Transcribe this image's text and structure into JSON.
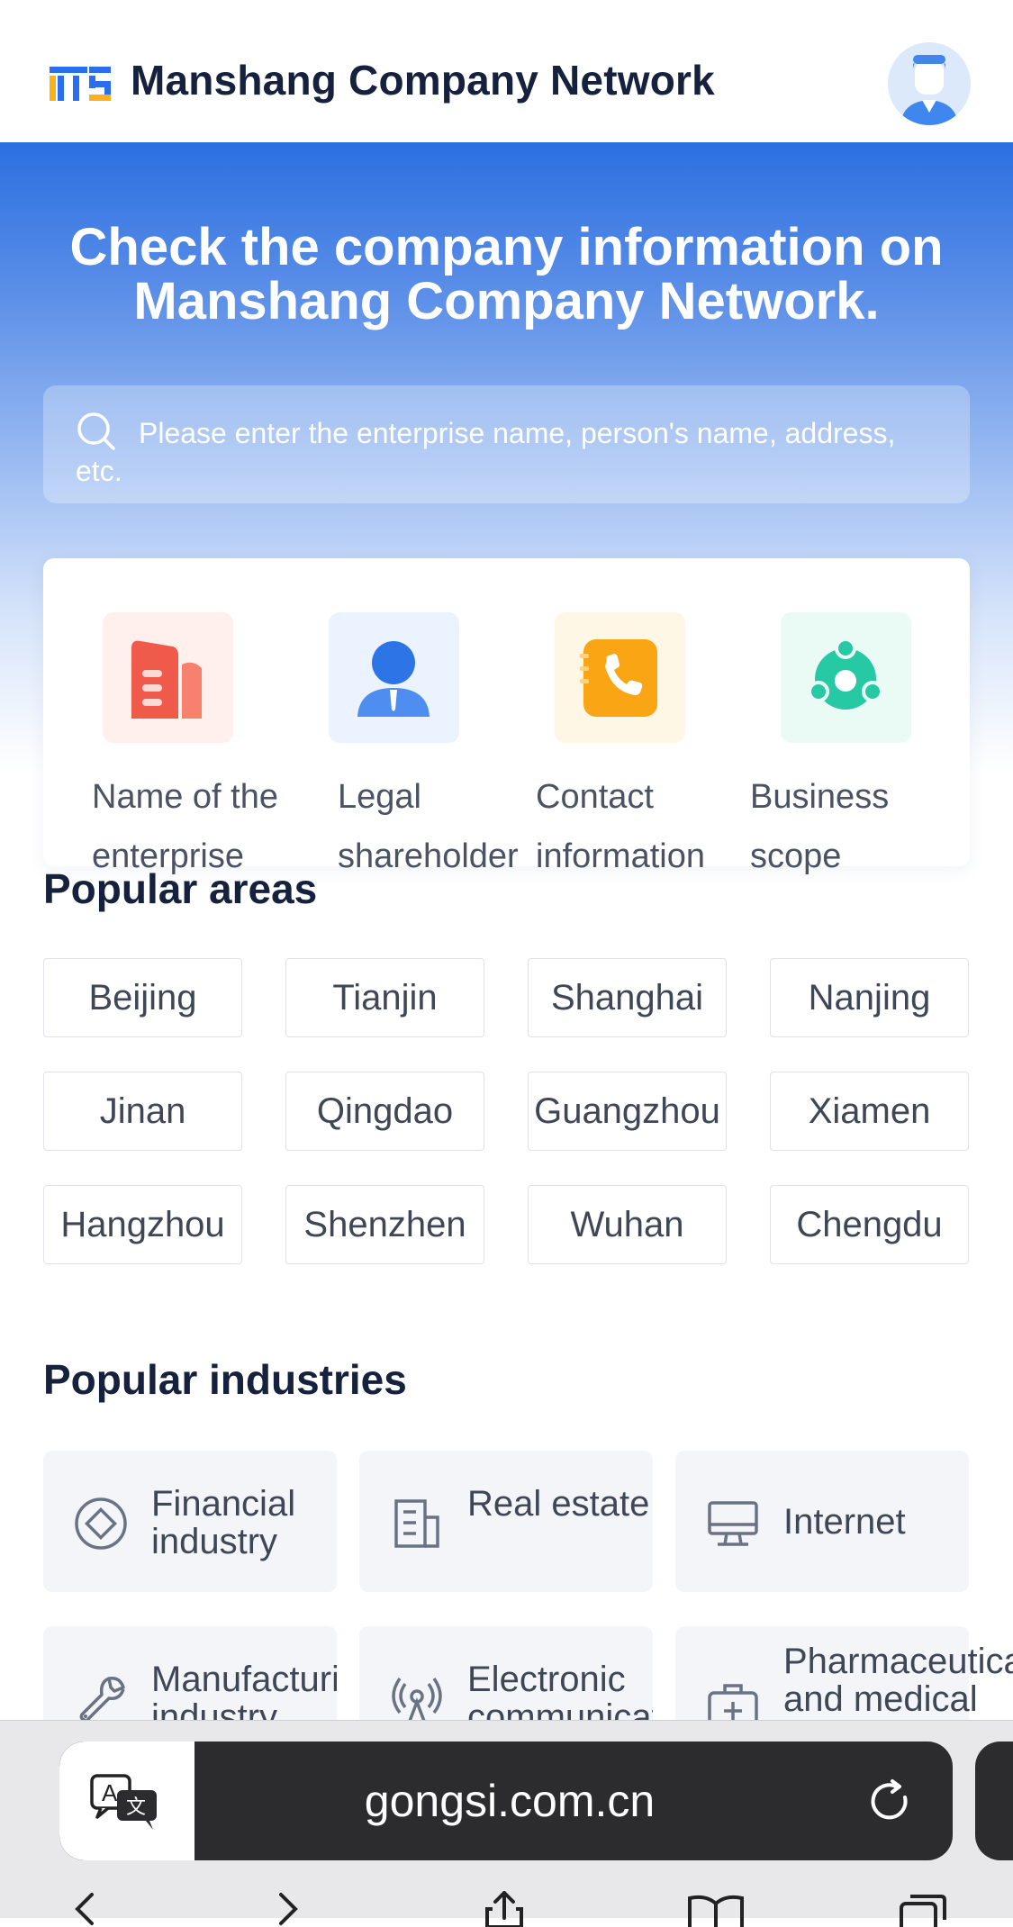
{
  "header": {
    "brand": "Manshang Company Network",
    "logo_icon": "mts-logo-icon",
    "avatar_icon": "user-avatar-icon",
    "colors": {
      "logo_blue": "#2a6ef0",
      "logo_orange": "#f7b21c",
      "brand_text": "#16213d"
    }
  },
  "hero": {
    "title": "Check the company information on Manshang Company Network.",
    "search": {
      "icon": "search-icon",
      "placeholder": "Please enter the enterprise name, person's name, address, etc."
    },
    "gradient": {
      "top": "#2b6fe0",
      "bottom": "#ffffff"
    }
  },
  "features": [
    {
      "icon": "building-icon",
      "label": "Name of the enterprise",
      "color": "#f05a4a"
    },
    {
      "icon": "person-icon",
      "label": "Legal shareholder",
      "color": "#2d74e6"
    },
    {
      "icon": "phone-book-icon",
      "label": "Contact information",
      "color": "#f9a514"
    },
    {
      "icon": "scope-nodes-icon",
      "label": "Business scope",
      "color": "#27c8a4"
    }
  ],
  "areas": {
    "title": "Popular areas",
    "items": [
      "Beijing",
      "Tianjin",
      "Shanghai",
      "Nanjing",
      "Jinan",
      "Qingdao",
      "Guangzhou",
      "Xiamen",
      "Hangzhou",
      "Shenzhen",
      "Wuhan",
      "Chengdu"
    ]
  },
  "industries": {
    "title": "Popular industries",
    "items": [
      {
        "icon": "diamond-coin-icon",
        "label": "Financial industry"
      },
      {
        "icon": "office-building-icon",
        "label": "Real estate"
      },
      {
        "icon": "monitor-icon",
        "label": "Internet"
      },
      {
        "icon": "wrench-icon",
        "label": "Manufacturing industry"
      },
      {
        "icon": "signal-tower-icon",
        "label": "Electronic communication"
      },
      {
        "icon": "medical-kit-icon",
        "label": "Pharmaceutical and medical"
      }
    ]
  },
  "browser": {
    "translate_icon": "translate-icon",
    "url": "gongsi.com.cn",
    "reload_icon": "reload-icon"
  }
}
